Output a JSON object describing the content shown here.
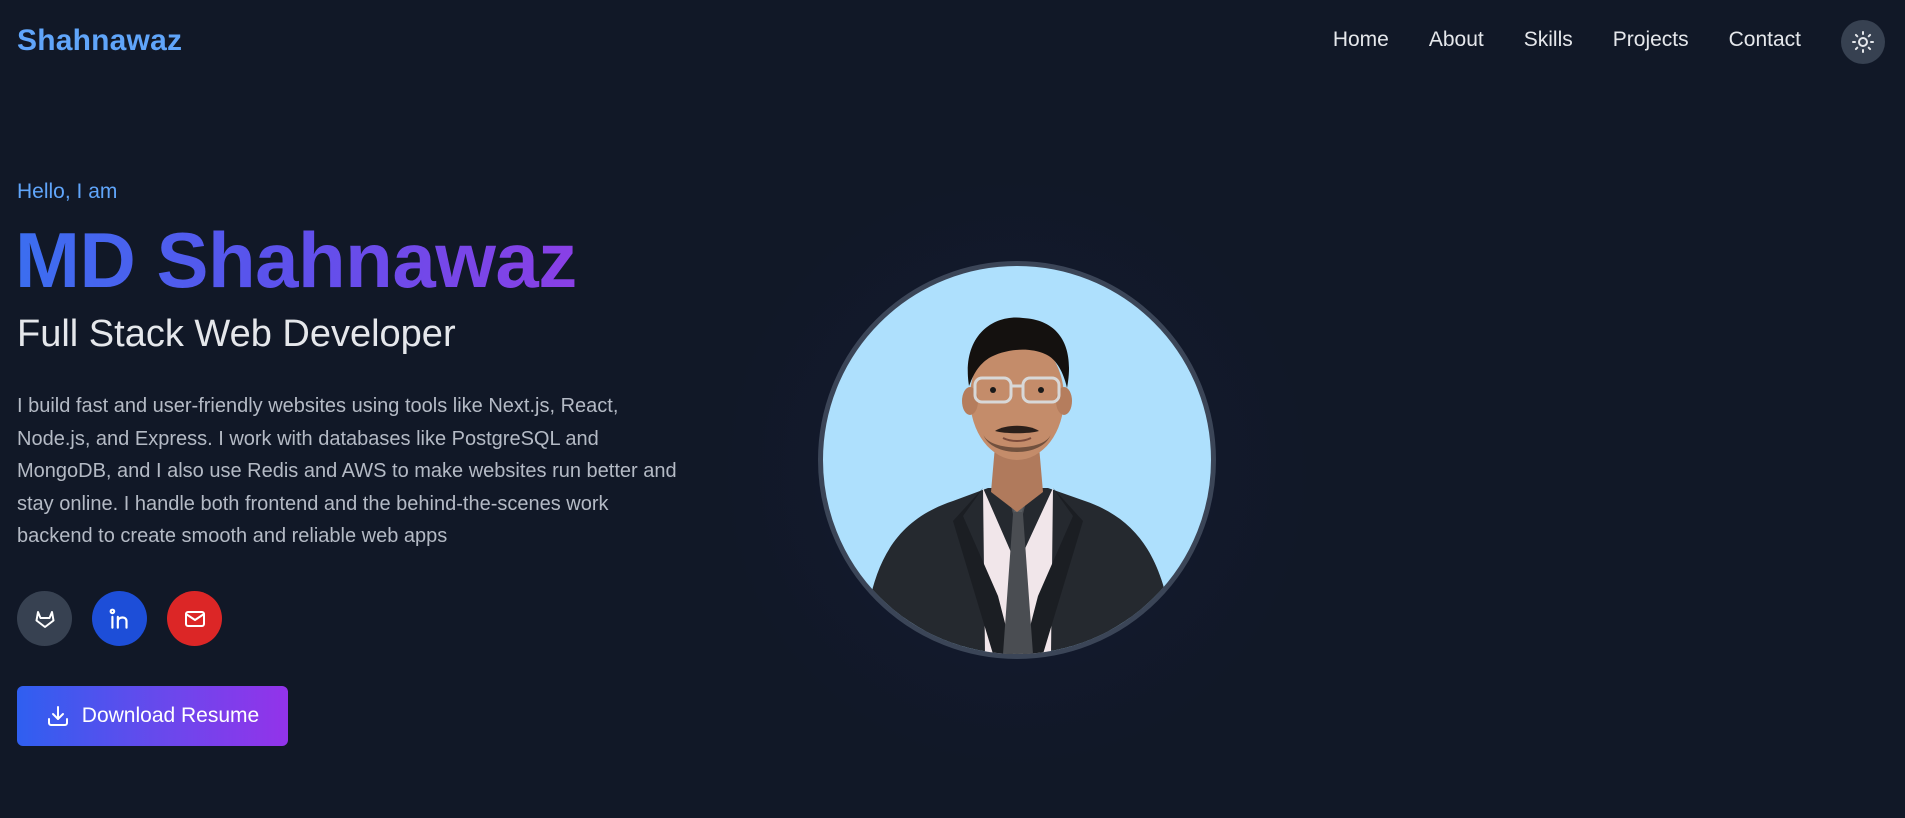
{
  "nav": {
    "brand": "Shahnawaz",
    "links": [
      "Home",
      "About",
      "Skills",
      "Projects",
      "Contact"
    ],
    "theme_icon": "sun-icon"
  },
  "hero": {
    "greeting": "Hello, I am",
    "name": "MD Shahnawaz",
    "role": "Full Stack Web Developer",
    "bio": "I build fast and user-friendly websites using tools like Next.js, React, Node.js, and Express. I work with databases like PostgreSQL and MongoDB, and I also use Redis and AWS to make websites run better and stay online. I handle both frontend and the behind-the-scenes work backend to create smooth and reliable web apps",
    "socials": [
      {
        "icon": "gitlab-icon",
        "color": "#374151"
      },
      {
        "icon": "linkedin-icon",
        "color": "#1d4ed8"
      },
      {
        "icon": "mail-icon",
        "color": "#dc2626"
      }
    ],
    "resume_button": "Download Resume"
  },
  "colors": {
    "background": "#111827",
    "accent": "#60a5fa",
    "gradient_start": "#2f5ff0",
    "gradient_end": "#9333ea",
    "portrait_bg": "#aee0fd"
  }
}
